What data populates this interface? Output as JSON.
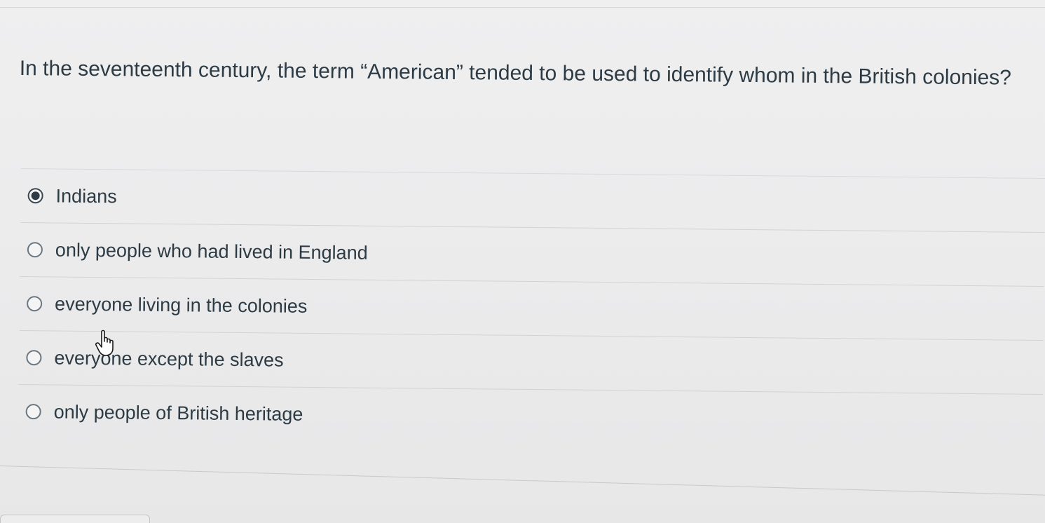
{
  "question": {
    "text": "In the seventeenth century, the term “American” tended to be used to identify whom in the British colonies?"
  },
  "answers": [
    {
      "label": "Indians",
      "selected": true
    },
    {
      "label": "only people who had lived in England",
      "selected": false
    },
    {
      "label": "everyone living in the colonies",
      "selected": false
    },
    {
      "label": "everyone except the slaves",
      "selected": false
    },
    {
      "label": "only people of British heritage",
      "selected": false
    }
  ],
  "cursor": {
    "icon": "hand-pointer-icon"
  }
}
